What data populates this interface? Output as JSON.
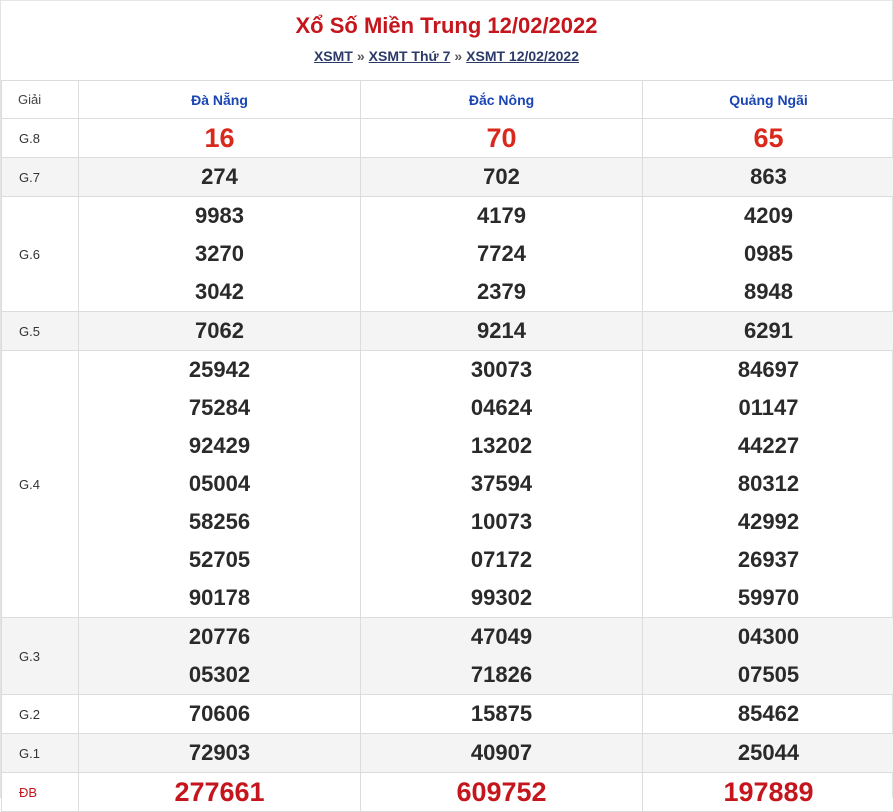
{
  "title": "Xổ Số Miền Trung 12/02/2022",
  "breadcrumb": [
    "XSMT",
    "XSMT Thứ 7",
    "XSMT 12/02/2022"
  ],
  "breadcrumb_sep": "»",
  "table": {
    "header_label": "Giải",
    "provinces": [
      "Đà Nẵng",
      "Đắc Nông",
      "Quảng Ngãi"
    ],
    "prizes": [
      {
        "label": "G.8",
        "values": [
          [
            "16"
          ],
          [
            "70"
          ],
          [
            "65"
          ]
        ]
      },
      {
        "label": "G.7",
        "values": [
          [
            "274"
          ],
          [
            "702"
          ],
          [
            "863"
          ]
        ]
      },
      {
        "label": "G.6",
        "values": [
          [
            "9983",
            "3270",
            "3042"
          ],
          [
            "4179",
            "7724",
            "2379"
          ],
          [
            "4209",
            "0985",
            "8948"
          ]
        ]
      },
      {
        "label": "G.5",
        "values": [
          [
            "7062"
          ],
          [
            "9214"
          ],
          [
            "6291"
          ]
        ]
      },
      {
        "label": "G.4",
        "values": [
          [
            "25942",
            "75284",
            "92429",
            "05004",
            "58256",
            "52705",
            "90178"
          ],
          [
            "30073",
            "04624",
            "13202",
            "37594",
            "10073",
            "07172",
            "99302"
          ],
          [
            "84697",
            "01147",
            "44227",
            "80312",
            "42992",
            "26937",
            "59970"
          ]
        ]
      },
      {
        "label": "G.3",
        "values": [
          [
            "20776",
            "05302"
          ],
          [
            "47049",
            "71826"
          ],
          [
            "04300",
            "07505"
          ]
        ]
      },
      {
        "label": "G.2",
        "values": [
          [
            "70606"
          ],
          [
            "15875"
          ],
          [
            "85462"
          ]
        ]
      },
      {
        "label": "G.1",
        "values": [
          [
            "72903"
          ],
          [
            "40907"
          ],
          [
            "25044"
          ]
        ]
      },
      {
        "label": "ĐB",
        "values": [
          [
            "277661"
          ],
          [
            "609752"
          ],
          [
            "197889"
          ]
        ]
      }
    ]
  }
}
